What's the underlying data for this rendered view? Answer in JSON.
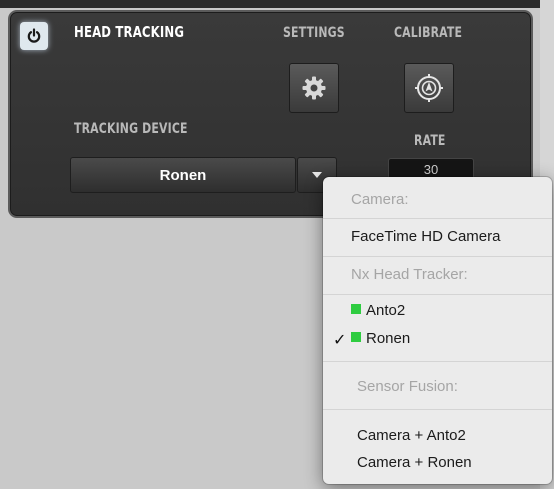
{
  "panel": {
    "title": "HEAD TRACKING",
    "settings_label": "SETTINGS",
    "calibrate_label": "CALIBRATE",
    "tracking_device_label": "TRACKING DEVICE",
    "rate_label": "RATE",
    "selected_device": "Ronen",
    "rate_value": "30"
  },
  "menu": {
    "camera_header": "Camera:",
    "camera_item": "FaceTime HD Camera",
    "nx_header": "Nx Head Tracker:",
    "nx_items": [
      "Anto2",
      "Ronen"
    ],
    "checked_item": "Ronen",
    "fusion_header": "Sensor Fusion:",
    "fusion_items": [
      "Camera + Anto2",
      "Camera + Ronen"
    ],
    "indicator_color": "#2ecc40"
  },
  "icons": [
    "power-icon",
    "gear-icon",
    "calibrate-icon",
    "dropdown-arrow-icon",
    "checkmark-icon"
  ]
}
